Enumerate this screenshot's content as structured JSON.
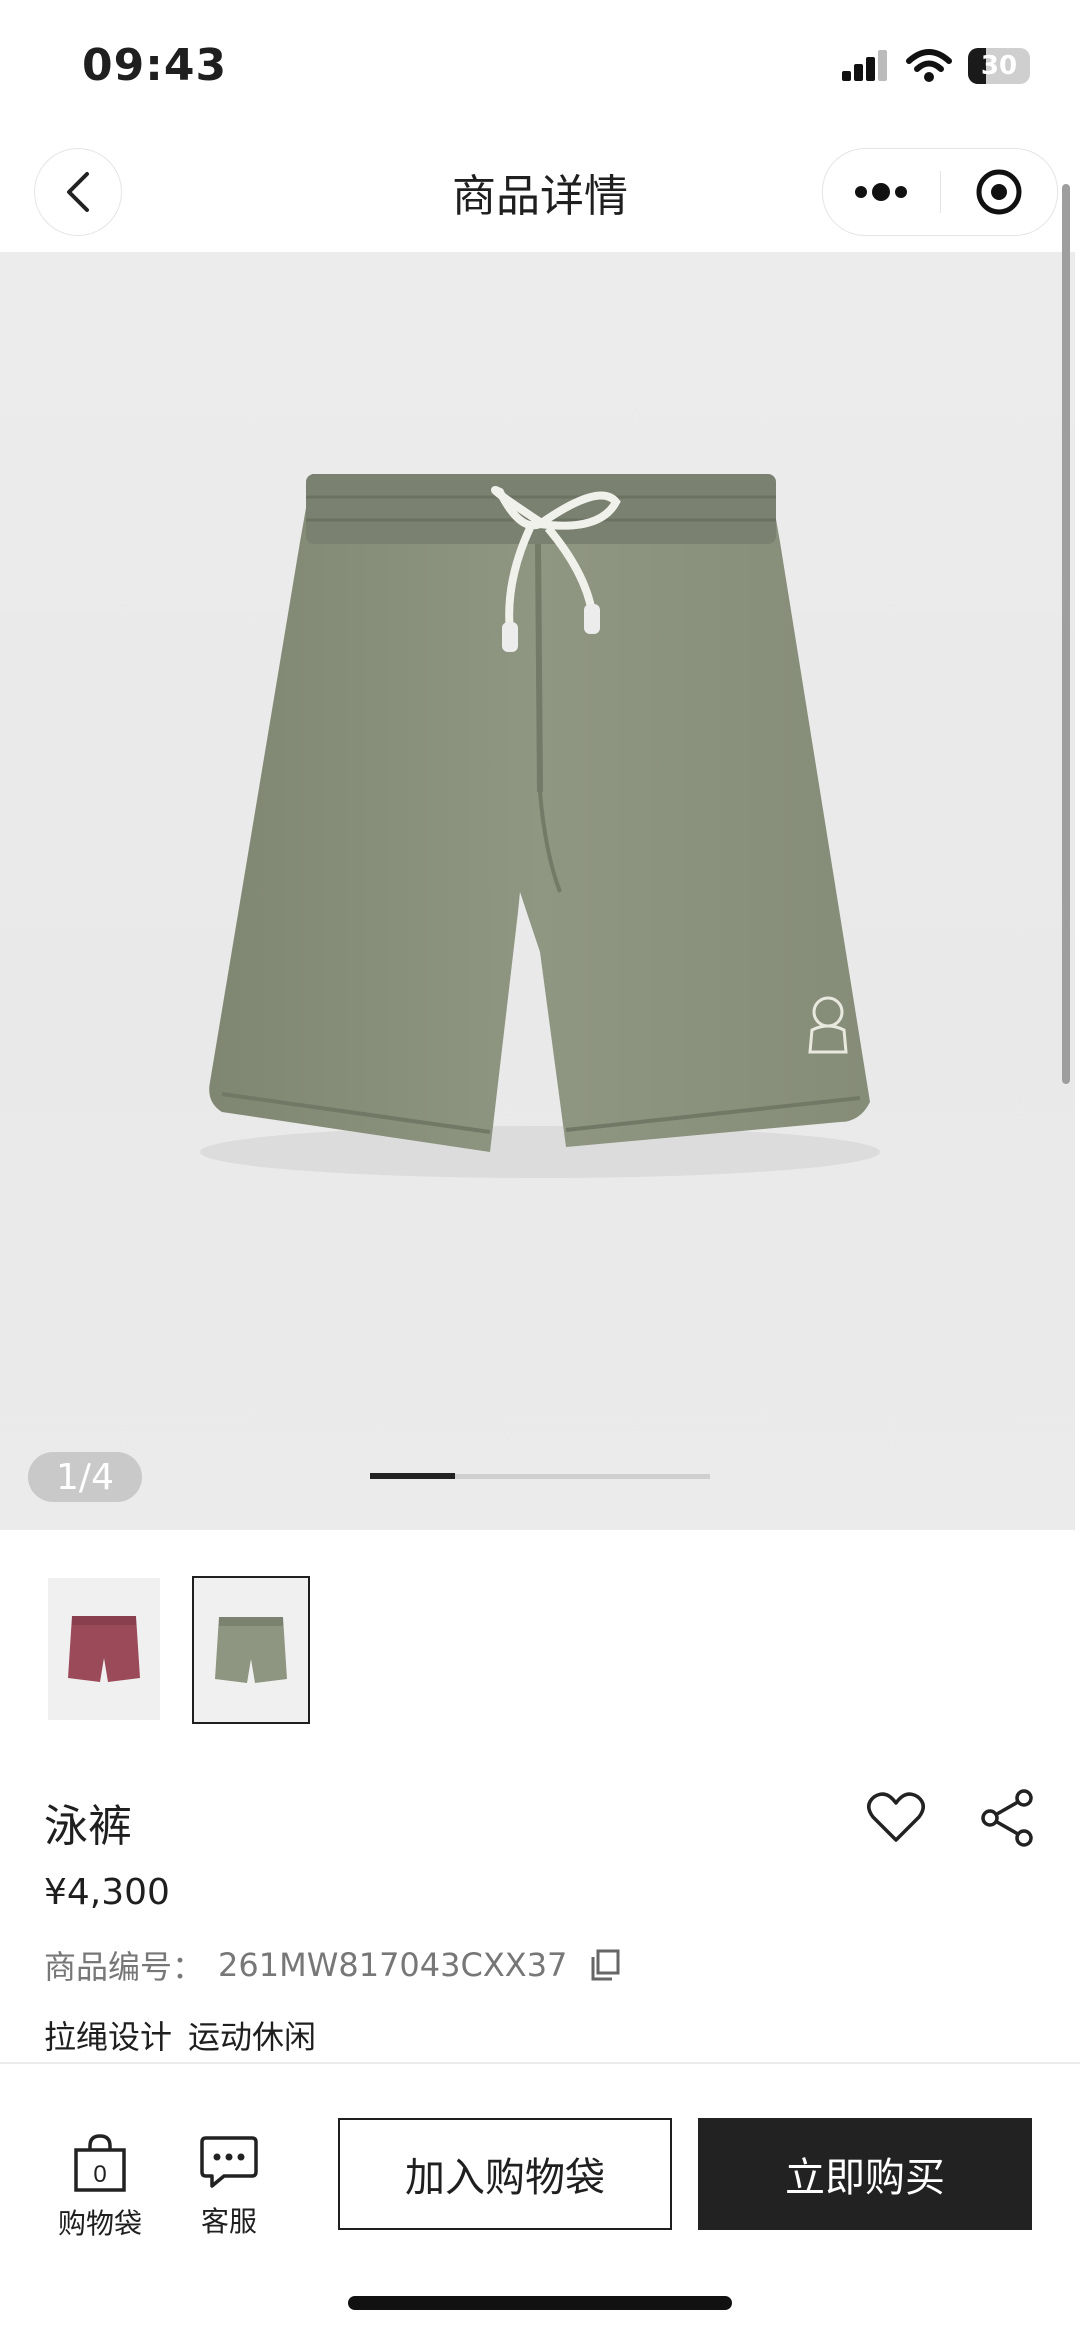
{
  "status_bar": {
    "time": "09:43",
    "battery": "30"
  },
  "nav": {
    "title": "商品详情"
  },
  "gallery": {
    "counter": "1/4",
    "progress": 0.25
  },
  "product": {
    "name": "泳裤",
    "price": "¥4,300",
    "code_label": "商品编号：",
    "code": "261MW817043CXX37",
    "tags": [
      "拉绳设计",
      "运动休闲"
    ]
  },
  "thumbnails": [
    {
      "color": "#9b4a5a",
      "selected": false
    },
    {
      "color": "#8e9580",
      "selected": true
    }
  ],
  "bottom_bar": {
    "bag_label": "购物袋",
    "bag_count": "0",
    "service_label": "客服",
    "add_to_bag": "加入购物袋",
    "buy_now": "立即购买"
  },
  "icons": [
    "back-icon",
    "more-icon",
    "target-icon",
    "heart-icon",
    "share-icon",
    "copy-icon",
    "bag-icon",
    "chat-icon",
    "signal-icon",
    "wifi-icon",
    "battery-icon"
  ]
}
